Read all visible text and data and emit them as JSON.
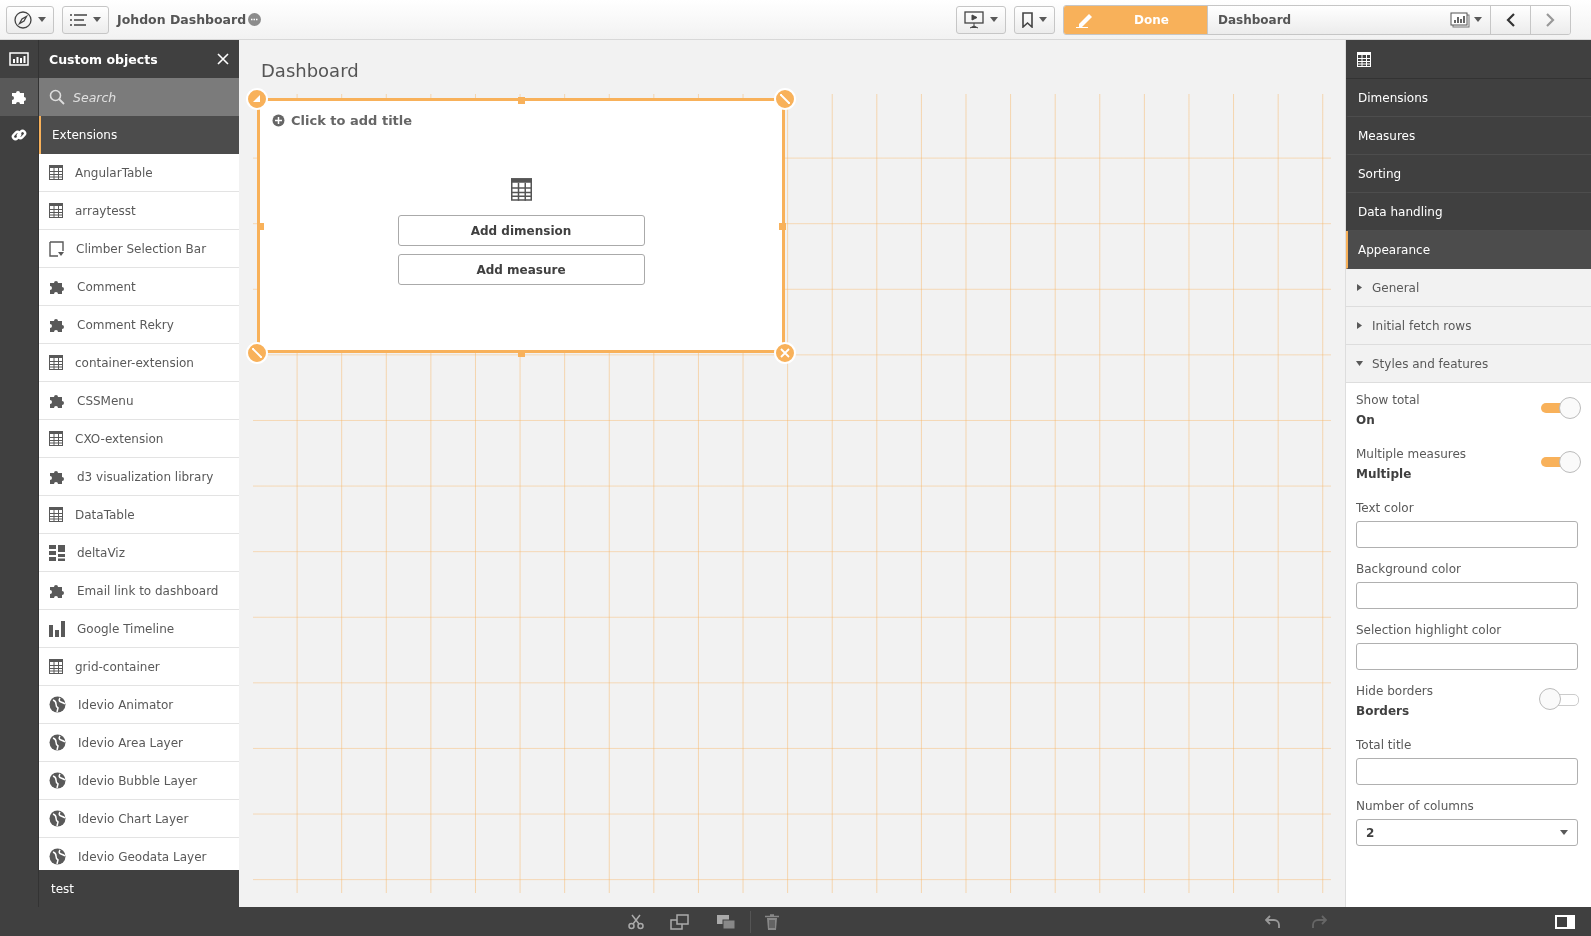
{
  "topbar": {
    "app_title": "Johdon Dashboard",
    "done_label": "Done",
    "sheet_name": "Dashboard"
  },
  "rail": [
    {
      "kind": "chart",
      "selected": false
    },
    {
      "kind": "puzzle",
      "selected": true
    },
    {
      "kind": "link",
      "selected": false
    }
  ],
  "sidebar": {
    "title": "Custom objects",
    "search": {
      "placeholder": "Search"
    },
    "section": "Extensions",
    "items": [
      {
        "label": "AngularTable",
        "kind": "table"
      },
      {
        "label": "arraytesst",
        "kind": "table"
      },
      {
        "label": "Climber Selection Bar",
        "kind": "selection"
      },
      {
        "label": "Comment",
        "kind": "puzzle"
      },
      {
        "label": "Comment Rekry",
        "kind": "puzzle"
      },
      {
        "label": "container-extension",
        "kind": "table"
      },
      {
        "label": "CSSMenu",
        "kind": "puzzle"
      },
      {
        "label": "CXO-extension",
        "kind": "table"
      },
      {
        "label": "d3 visualization library",
        "kind": "puzzle"
      },
      {
        "label": "DataTable",
        "kind": "table"
      },
      {
        "label": "deltaViz",
        "kind": "grid"
      },
      {
        "label": "Email link to dashboard",
        "kind": "puzzle"
      },
      {
        "label": "Google Timeline",
        "kind": "bars"
      },
      {
        "label": "grid-container",
        "kind": "table"
      },
      {
        "label": "Idevio Animator",
        "kind": "globe"
      },
      {
        "label": "Idevio Area Layer",
        "kind": "globe"
      },
      {
        "label": "Idevio Bubble Layer",
        "kind": "globe"
      },
      {
        "label": "Idevio Chart Layer",
        "kind": "globe"
      },
      {
        "label": "Idevio Geodata Layer",
        "kind": "globe"
      }
    ],
    "footer": "test"
  },
  "canvas": {
    "title": "Dashboard",
    "card": {
      "title_prompt": "Click to add title",
      "buttons": [
        "Add dimension",
        "Add measure"
      ]
    }
  },
  "properties": {
    "sections": [
      {
        "label": "Dimensions",
        "selected": false
      },
      {
        "label": "Measures",
        "selected": false
      },
      {
        "label": "Sorting",
        "selected": false
      },
      {
        "label": "Data handling",
        "selected": false
      },
      {
        "label": "Appearance",
        "selected": true
      }
    ],
    "groups": [
      {
        "label": "General",
        "expanded": false
      },
      {
        "label": "Initial fetch rows",
        "expanded": false
      },
      {
        "label": "Styles and features",
        "expanded": true
      }
    ],
    "fields": [
      {
        "kind": "toggle",
        "label": "Show total",
        "value": "On",
        "on": true
      },
      {
        "kind": "toggle",
        "label": "Multiple measures",
        "value": "Multiple",
        "on": true
      },
      {
        "kind": "input",
        "label": "Text color"
      },
      {
        "kind": "input",
        "label": "Background color"
      },
      {
        "kind": "input",
        "label": "Selection highlight color"
      },
      {
        "kind": "toggle",
        "label": "Hide borders",
        "value": "Borders",
        "on": false
      },
      {
        "kind": "input",
        "label": "Total title"
      },
      {
        "kind": "select",
        "label": "Number of columns",
        "value": "2"
      }
    ]
  }
}
